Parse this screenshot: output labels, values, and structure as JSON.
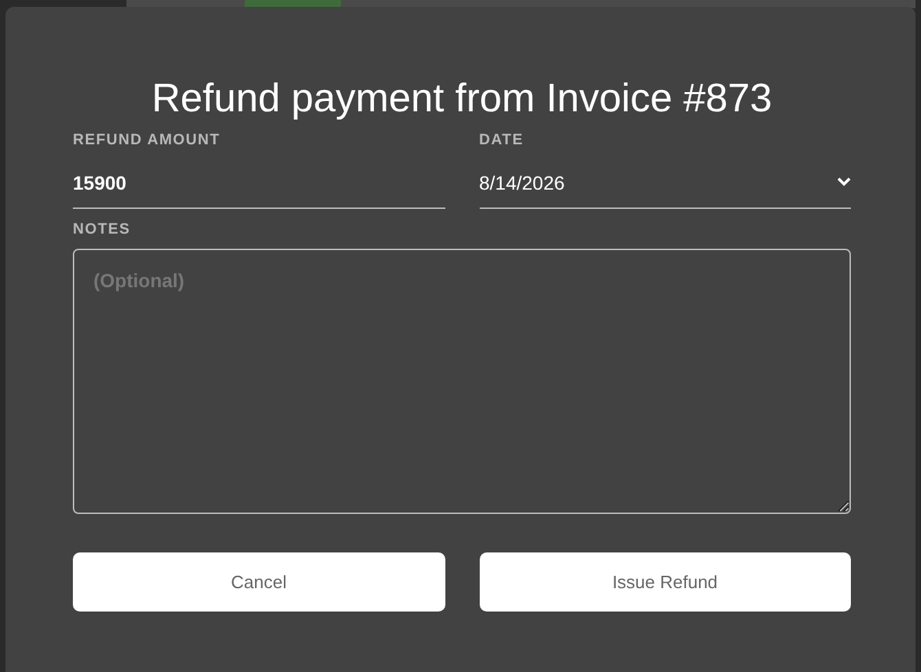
{
  "dialog": {
    "title": "Refund payment from Invoice #873",
    "fields": [
      {
        "kind": "text",
        "label": "REFUND AMOUNT",
        "value": "15900"
      },
      {
        "kind": "select",
        "label": "DATE",
        "value": "8/14/2026"
      }
    ],
    "notes": {
      "label": "NOTES",
      "placeholder": "(Optional)"
    },
    "buttons": [
      "Cancel",
      "Issue Refund"
    ]
  }
}
